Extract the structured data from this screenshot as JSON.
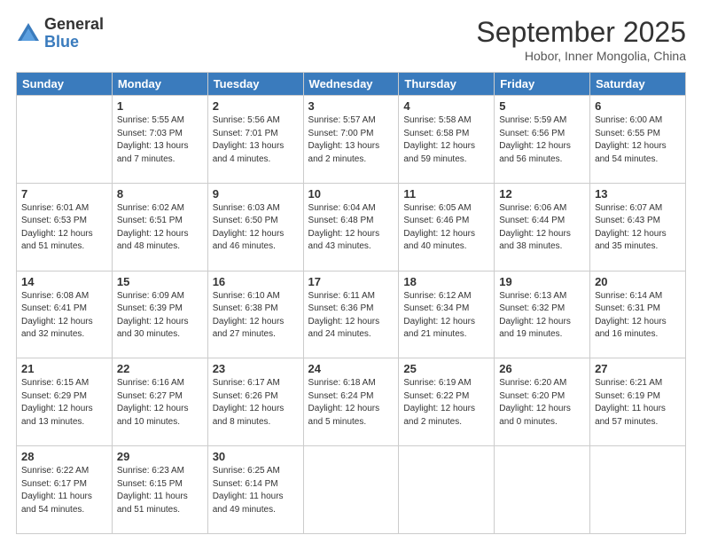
{
  "logo": {
    "general": "General",
    "blue": "Blue"
  },
  "title": "September 2025",
  "subtitle": "Hobor, Inner Mongolia, China",
  "header_days": [
    "Sunday",
    "Monday",
    "Tuesday",
    "Wednesday",
    "Thursday",
    "Friday",
    "Saturday"
  ],
  "weeks": [
    [
      {
        "day": "",
        "sunrise": "",
        "sunset": "",
        "daylight": ""
      },
      {
        "day": "1",
        "sunrise": "5:55 AM",
        "sunset": "7:03 PM",
        "daylight": "13 hours and 7 minutes."
      },
      {
        "day": "2",
        "sunrise": "5:56 AM",
        "sunset": "7:01 PM",
        "daylight": "13 hours and 4 minutes."
      },
      {
        "day": "3",
        "sunrise": "5:57 AM",
        "sunset": "7:00 PM",
        "daylight": "13 hours and 2 minutes."
      },
      {
        "day": "4",
        "sunrise": "5:58 AM",
        "sunset": "6:58 PM",
        "daylight": "12 hours and 59 minutes."
      },
      {
        "day": "5",
        "sunrise": "5:59 AM",
        "sunset": "6:56 PM",
        "daylight": "12 hours and 56 minutes."
      },
      {
        "day": "6",
        "sunrise": "6:00 AM",
        "sunset": "6:55 PM",
        "daylight": "12 hours and 54 minutes."
      }
    ],
    [
      {
        "day": "7",
        "sunrise": "6:01 AM",
        "sunset": "6:53 PM",
        "daylight": "12 hours and 51 minutes."
      },
      {
        "day": "8",
        "sunrise": "6:02 AM",
        "sunset": "6:51 PM",
        "daylight": "12 hours and 48 minutes."
      },
      {
        "day": "9",
        "sunrise": "6:03 AM",
        "sunset": "6:50 PM",
        "daylight": "12 hours and 46 minutes."
      },
      {
        "day": "10",
        "sunrise": "6:04 AM",
        "sunset": "6:48 PM",
        "daylight": "12 hours and 43 minutes."
      },
      {
        "day": "11",
        "sunrise": "6:05 AM",
        "sunset": "6:46 PM",
        "daylight": "12 hours and 40 minutes."
      },
      {
        "day": "12",
        "sunrise": "6:06 AM",
        "sunset": "6:44 PM",
        "daylight": "12 hours and 38 minutes."
      },
      {
        "day": "13",
        "sunrise": "6:07 AM",
        "sunset": "6:43 PM",
        "daylight": "12 hours and 35 minutes."
      }
    ],
    [
      {
        "day": "14",
        "sunrise": "6:08 AM",
        "sunset": "6:41 PM",
        "daylight": "12 hours and 32 minutes."
      },
      {
        "day": "15",
        "sunrise": "6:09 AM",
        "sunset": "6:39 PM",
        "daylight": "12 hours and 30 minutes."
      },
      {
        "day": "16",
        "sunrise": "6:10 AM",
        "sunset": "6:38 PM",
        "daylight": "12 hours and 27 minutes."
      },
      {
        "day": "17",
        "sunrise": "6:11 AM",
        "sunset": "6:36 PM",
        "daylight": "12 hours and 24 minutes."
      },
      {
        "day": "18",
        "sunrise": "6:12 AM",
        "sunset": "6:34 PM",
        "daylight": "12 hours and 21 minutes."
      },
      {
        "day": "19",
        "sunrise": "6:13 AM",
        "sunset": "6:32 PM",
        "daylight": "12 hours and 19 minutes."
      },
      {
        "day": "20",
        "sunrise": "6:14 AM",
        "sunset": "6:31 PM",
        "daylight": "12 hours and 16 minutes."
      }
    ],
    [
      {
        "day": "21",
        "sunrise": "6:15 AM",
        "sunset": "6:29 PM",
        "daylight": "12 hours and 13 minutes."
      },
      {
        "day": "22",
        "sunrise": "6:16 AM",
        "sunset": "6:27 PM",
        "daylight": "12 hours and 10 minutes."
      },
      {
        "day": "23",
        "sunrise": "6:17 AM",
        "sunset": "6:26 PM",
        "daylight": "12 hours and 8 minutes."
      },
      {
        "day": "24",
        "sunrise": "6:18 AM",
        "sunset": "6:24 PM",
        "daylight": "12 hours and 5 minutes."
      },
      {
        "day": "25",
        "sunrise": "6:19 AM",
        "sunset": "6:22 PM",
        "daylight": "12 hours and 2 minutes."
      },
      {
        "day": "26",
        "sunrise": "6:20 AM",
        "sunset": "6:20 PM",
        "daylight": "12 hours and 0 minutes."
      },
      {
        "day": "27",
        "sunrise": "6:21 AM",
        "sunset": "6:19 PM",
        "daylight": "11 hours and 57 minutes."
      }
    ],
    [
      {
        "day": "28",
        "sunrise": "6:22 AM",
        "sunset": "6:17 PM",
        "daylight": "11 hours and 54 minutes."
      },
      {
        "day": "29",
        "sunrise": "6:23 AM",
        "sunset": "6:15 PM",
        "daylight": "11 hours and 51 minutes."
      },
      {
        "day": "30",
        "sunrise": "6:25 AM",
        "sunset": "6:14 PM",
        "daylight": "11 hours and 49 minutes."
      },
      {
        "day": "",
        "sunrise": "",
        "sunset": "",
        "daylight": ""
      },
      {
        "day": "",
        "sunrise": "",
        "sunset": "",
        "daylight": ""
      },
      {
        "day": "",
        "sunrise": "",
        "sunset": "",
        "daylight": ""
      },
      {
        "day": "",
        "sunrise": "",
        "sunset": "",
        "daylight": ""
      }
    ]
  ]
}
